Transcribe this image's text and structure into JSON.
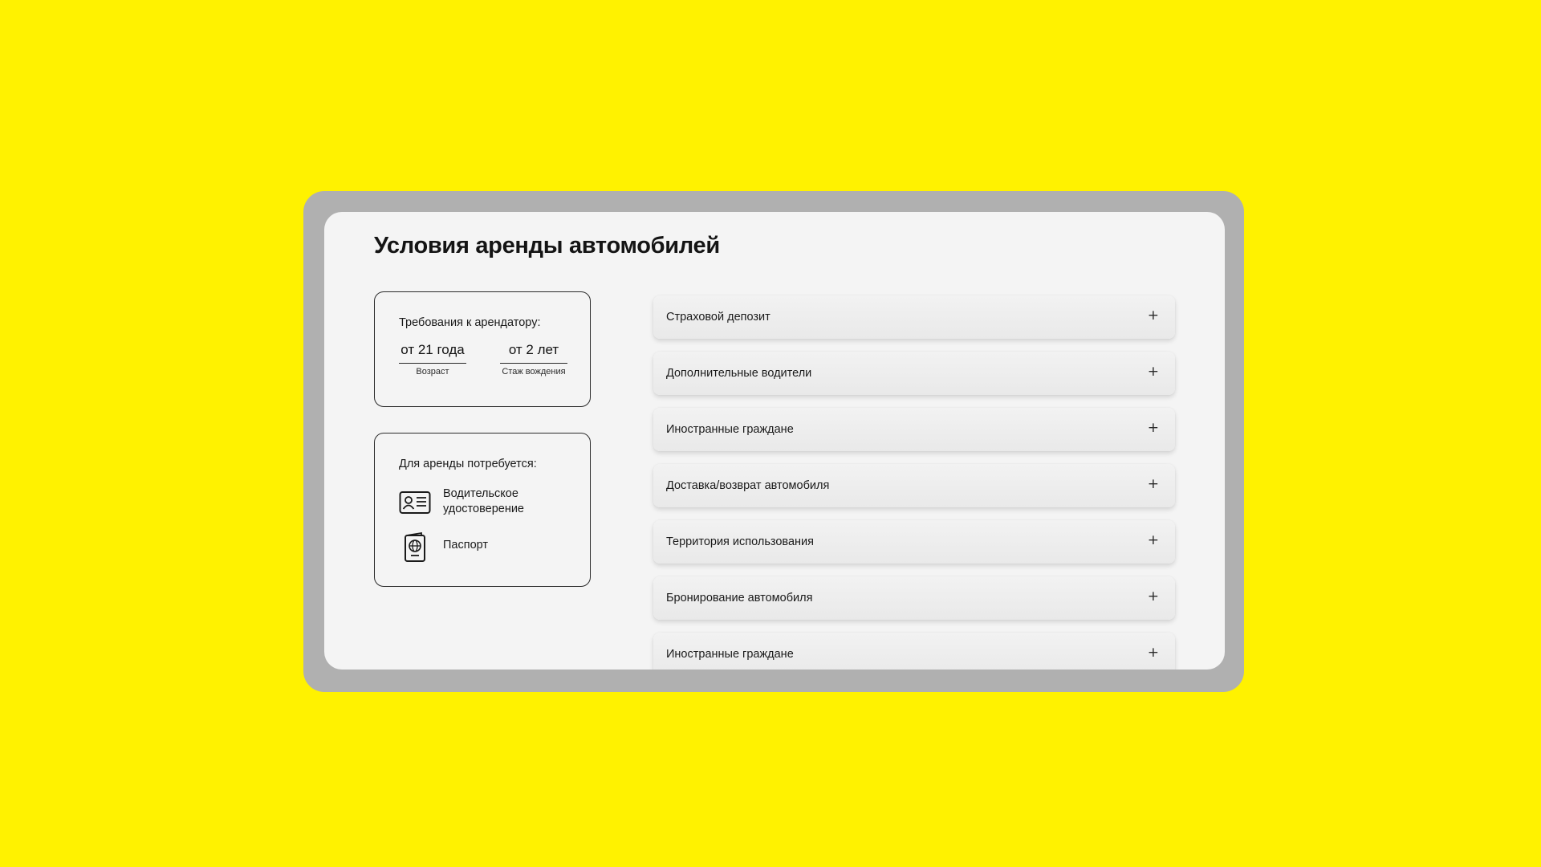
{
  "page": {
    "title": "Условия аренды автомобилей"
  },
  "requirements": {
    "heading": "Требования к арендатору:",
    "age_value": "от 21 года",
    "age_label": "Возраст",
    "experience_value": "от 2 лет",
    "experience_label": "Стаж вождения"
  },
  "documents": {
    "heading": "Для аренды потребуется:",
    "items": [
      {
        "label": "Водительское удостоверение",
        "icon": "driver-license-icon"
      },
      {
        "label": "Паспорт",
        "icon": "passport-icon"
      }
    ]
  },
  "accordion": {
    "expand_symbol": "+",
    "items": [
      {
        "label": "Страховой депозит"
      },
      {
        "label": "Дополнительные водители"
      },
      {
        "label": "Иностранные граждане"
      },
      {
        "label": "Доставка/возврат автомобиля"
      },
      {
        "label": "Территория использования"
      },
      {
        "label": "Бронирование автомобиля"
      },
      {
        "label": "Иностранные граждане"
      }
    ]
  },
  "colors": {
    "background": "#fff200",
    "frame": "#b0b0b0",
    "card": "#f4f4f4",
    "text": "#141414"
  }
}
